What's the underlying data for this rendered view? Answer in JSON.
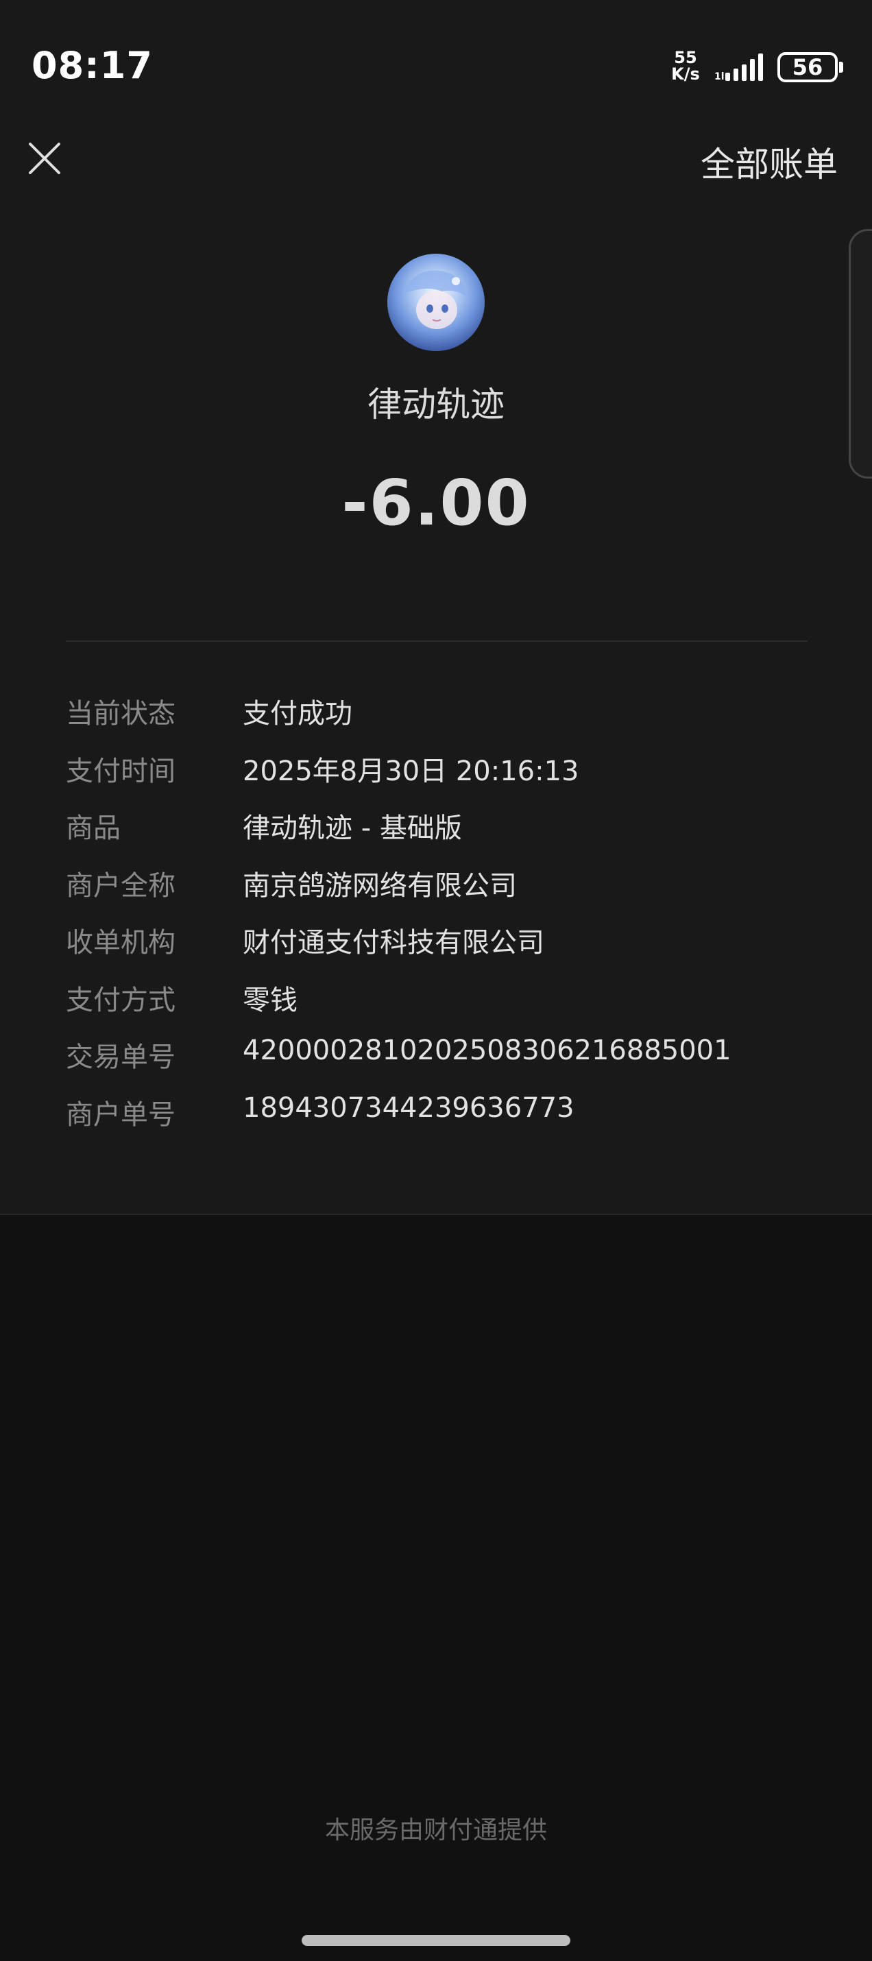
{
  "status_bar": {
    "time": "08:17",
    "net_speed_value": "55",
    "net_speed_unit": "K/s",
    "battery": "56"
  },
  "header": {
    "all_bills_label": "全部账单"
  },
  "merchant": {
    "name": "律动轨迹",
    "amount": "-6.00"
  },
  "details": [
    {
      "label": "当前状态",
      "value": "支付成功"
    },
    {
      "label": "支付时间",
      "value": "2025年8月30日 20:16:13"
    },
    {
      "label": "商品",
      "value": "律动轨迹 - 基础版"
    },
    {
      "label": "商户全称",
      "value": "南京鸽游网络有限公司"
    },
    {
      "label": "收单机构",
      "value": "财付通支付科技有限公司"
    },
    {
      "label": "支付方式",
      "value": "零钱"
    },
    {
      "label": "交易单号",
      "value": "4200002810202508306216885001"
    },
    {
      "label": "商户单号",
      "value": "1894307344239636773"
    }
  ],
  "footer": {
    "text": "本服务由财付通提供"
  }
}
